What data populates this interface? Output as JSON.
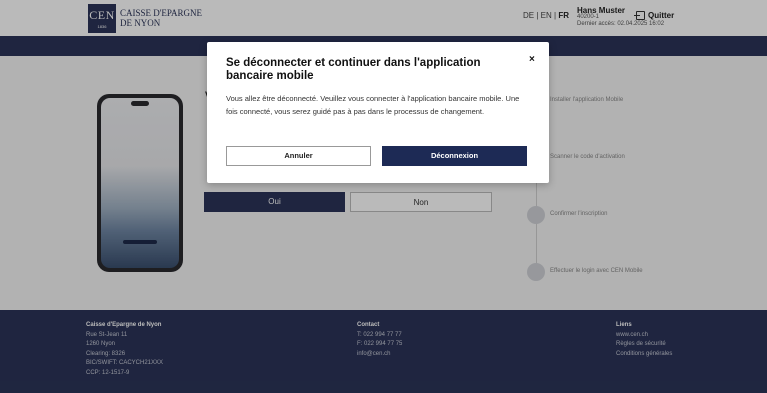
{
  "header": {
    "logo_mark": "CEN",
    "logo_year": "1836",
    "bank_name_line1": "CAISSE D'EPARGNE",
    "bank_name_line2": "DE NYON",
    "languages": [
      "DE",
      "EN",
      "FR"
    ],
    "active_language": "FR",
    "user_name": "Hans Muster",
    "user_id": "40200-1",
    "last_access": "Dernier accès: 02.04.2025 16:02",
    "quit_label": "Quitter"
  },
  "main": {
    "question_initial": "V",
    "yes_label": "Oui",
    "no_label": "Non",
    "steps": [
      {
        "label": "Installer l'application Mobile"
      },
      {
        "label": "Scanner le code d'activation"
      },
      {
        "label": "Confirmer l'inscription"
      },
      {
        "label": "Effectuer le login avec CEN Mobile"
      }
    ]
  },
  "footer": {
    "address_title": "Caisse d'Epargne de Nyon",
    "address_lines": [
      "Rue St-Jean 11",
      "1260 Nyon",
      "Clearing: 8326",
      "BIC/SWIFT: CACYCH21XXX",
      "CCP: 12-1517-9"
    ],
    "contact_title": "Contact",
    "contact_lines": [
      "T: 022 994 77 77",
      "F: 022 994 77 75",
      "info@cen.ch"
    ],
    "links_title": "Liens",
    "links": [
      "www.cen.ch",
      "Règles de sécurité",
      "Conditions générales"
    ]
  },
  "modal": {
    "title": "Se déconnecter et continuer dans l'application bancaire mobile",
    "close_symbol": "×",
    "body": "Vous allez être déconnecté. Veuillez vous connecter à l'application bancaire mobile. Une fois connecté, vous serez guidé pas à pas dans le processus de changement.",
    "cancel_label": "Annuler",
    "logout_label": "Déconnexion"
  },
  "colors": {
    "brand_navy": "#2b3458",
    "button_navy": "#1d2a55"
  }
}
